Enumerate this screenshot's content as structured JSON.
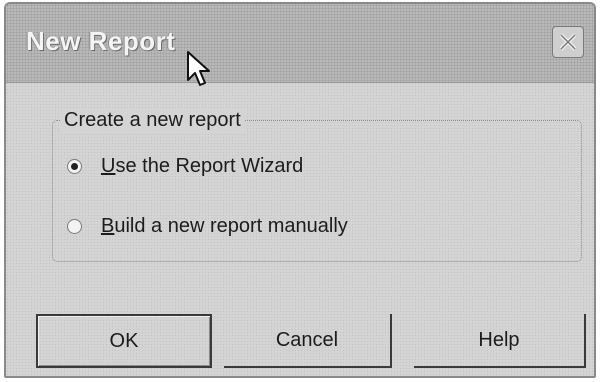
{
  "window": {
    "title": "New Report"
  },
  "group": {
    "legend": "Create a new report",
    "options": [
      {
        "prefix": "",
        "accel": "U",
        "rest": "se the Report Wizard",
        "selected": true
      },
      {
        "prefix": "",
        "accel": "B",
        "rest": "uild a new report manually",
        "selected": false
      }
    ]
  },
  "buttons": {
    "ok": "OK",
    "cancel": "Cancel",
    "help": "Help"
  },
  "icons": {
    "close": "close-icon",
    "cursor": "mouse-pointer-icon"
  }
}
